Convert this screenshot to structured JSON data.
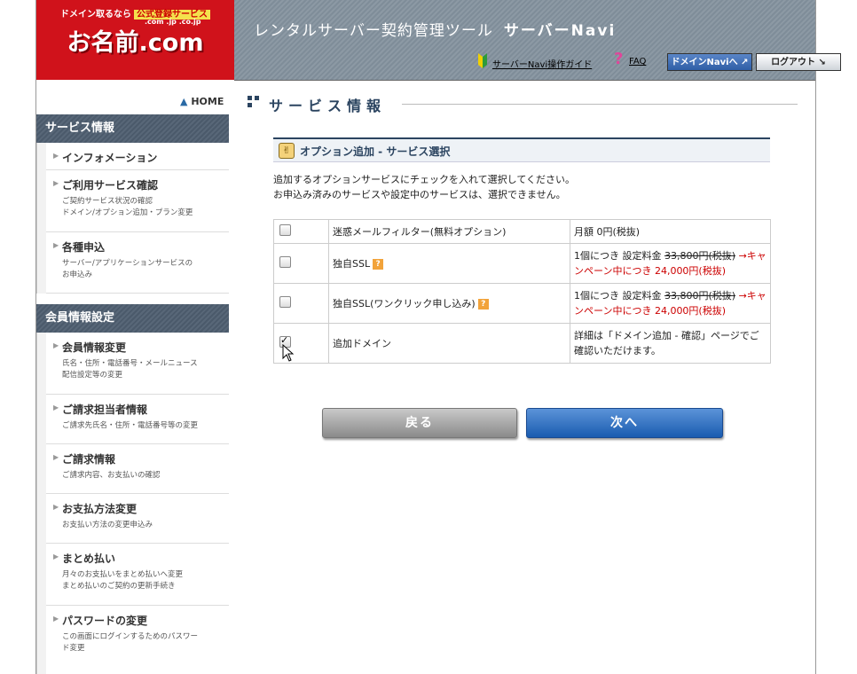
{
  "header": {
    "logo_top": "ドメイン取るなら",
    "logo_tag": "公式登録サービス",
    "logo_domains": ".com .jp .co.jp",
    "logo_main": "お名前.com",
    "tool_title": "レンタルサーバー契約管理ツール",
    "tool_name": "サーバーNavi",
    "guide_link": "サーバーNavi操作ガイド",
    "faq_link": "FAQ",
    "domain_navi_button": "ドメインNaviへ",
    "logout_button": "ログアウト"
  },
  "sidebar": {
    "home_label": "HOME",
    "section1_title": "サービス情報",
    "section1_items": [
      {
        "title": "インフォメーション",
        "desc": ""
      },
      {
        "title": "ご利用サービス確認",
        "desc": "ご契約サービス状況の確認\nドメイン/オプション追加・プラン変更"
      },
      {
        "title": "各種申込",
        "desc": "サーバー/アプリケーションサービスの\nお申込み"
      }
    ],
    "section2_title": "会員情報設定",
    "section2_items": [
      {
        "title": "会員情報変更",
        "desc": "氏名・住所・電話番号・メールニュース\n配信設定等の変更"
      },
      {
        "title": "ご請求担当者情報",
        "desc": "ご請求先氏名・住所・電話番号等の変更"
      },
      {
        "title": "ご請求情報",
        "desc": "ご請求内容、お支払いの確認"
      },
      {
        "title": "お支払方法変更",
        "desc": "お支払い方法の変更申込み"
      },
      {
        "title": "まとめ払い",
        "desc": "月々のお支払いをまとめ払いへ変更\nまとめ払いのご契約の更新手続き"
      },
      {
        "title": "パスワードの変更",
        "desc": "この画面にログインするためのパスワー\nド変更"
      }
    ]
  },
  "main": {
    "page_title": "サービス情報",
    "section_title": "オプション追加 - サービス選択",
    "intro_line1": "追加するオプションサービスにチェックを入れて選択してください。",
    "intro_line2": "お申込み済みのサービスや設定中のサービスは、選択できません。",
    "options": [
      {
        "name": "迷惑メールフィルター(無料オプション)",
        "checked": false,
        "help": false,
        "price_plain": "月額 0円(税抜)",
        "price_old": "",
        "price_campaign": ""
      },
      {
        "name": "独自SSL",
        "checked": false,
        "help": true,
        "price_plain": "1個につき 設定料金 ",
        "price_old": "33,800円(税抜)",
        "price_campaign": " →キャンペーン中につき 24,000円(税抜)"
      },
      {
        "name": "独自SSL(ワンクリック申し込み)",
        "checked": false,
        "help": true,
        "price_plain": "1個につき 設定料金 ",
        "price_old": "33,800円(税抜)",
        "price_campaign": " →キャンペーン中につき 24,000円(税抜)"
      },
      {
        "name": "追加ドメイン",
        "checked": true,
        "help": false,
        "price_plain": "詳細は「ドメイン追加 - 確認」ページでご確認いただけます。",
        "price_old": "",
        "price_campaign": ""
      }
    ],
    "back_button": "戻る",
    "next_button": "次へ",
    "help_icon_text": "?"
  },
  "colors": {
    "brand_red": "#d0121b",
    "header_gray": "#8c99a4",
    "navy": "#2b4460",
    "campaign_red": "#cc0000",
    "next_blue": "#1a5cb0"
  }
}
